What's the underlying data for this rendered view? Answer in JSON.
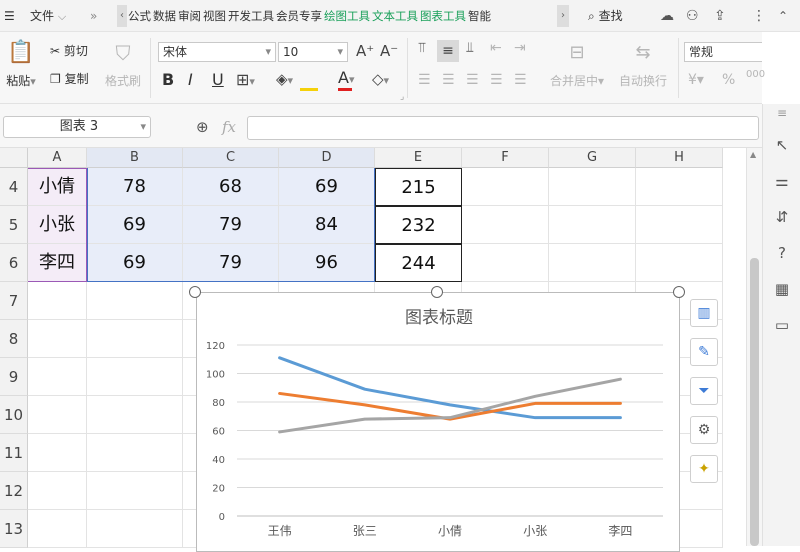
{
  "topbar": {
    "file_menu": "文件",
    "tabs": [
      "公式",
      "数据",
      "审阅",
      "视图",
      "开发工具",
      "会员专享",
      "绘图工具",
      "文本工具",
      "图表工具",
      "智能"
    ],
    "green_tabs": [
      "绘图工具",
      "文本工具",
      "图表工具"
    ],
    "search_label": "查找"
  },
  "ribbon": {
    "paste": "粘贴",
    "cut": "剪切",
    "copy": "复制",
    "format_painter": "格式刷",
    "font_name": "宋体",
    "font_size": "10",
    "merge_center": "合并居中",
    "auto_wrap": "自动换行",
    "number_format": "常规"
  },
  "formula_bar": {
    "name_box": "图表 3",
    "fx_label": "fx",
    "formula": ""
  },
  "sheet": {
    "columns": [
      "A",
      "B",
      "C",
      "D",
      "E",
      "F",
      "G",
      "H"
    ],
    "rows": [
      "4",
      "5",
      "6",
      "7",
      "8",
      "9",
      "10",
      "11",
      "12",
      "13"
    ],
    "data": [
      [
        "小倩",
        "78",
        "68",
        "69",
        "215"
      ],
      [
        "小张",
        "69",
        "79",
        "84",
        "232"
      ],
      [
        "李四",
        "69",
        "79",
        "96",
        "244"
      ]
    ]
  },
  "chart_data": {
    "type": "line",
    "title": "图表标题",
    "categories": [
      "王伟",
      "张三",
      "小倩",
      "小张",
      "李四"
    ],
    "yticks": [
      "0",
      "20",
      "40",
      "60",
      "80",
      "100",
      "120"
    ],
    "ylim": [
      0,
      120
    ],
    "grid": true,
    "series": [
      {
        "color": "#5b9bd5",
        "values": [
          111,
          89,
          78,
          69,
          69
        ]
      },
      {
        "color": "#ed7d31",
        "values": [
          86,
          78,
          68,
          79,
          79
        ]
      },
      {
        "color": "#a5a5a5",
        "values": [
          59,
          68,
          69,
          84,
          96
        ]
      }
    ]
  },
  "colors": {
    "accent_green": "#1aa05a",
    "selection": "#e8edf9",
    "selection_border": "#4472c4"
  }
}
